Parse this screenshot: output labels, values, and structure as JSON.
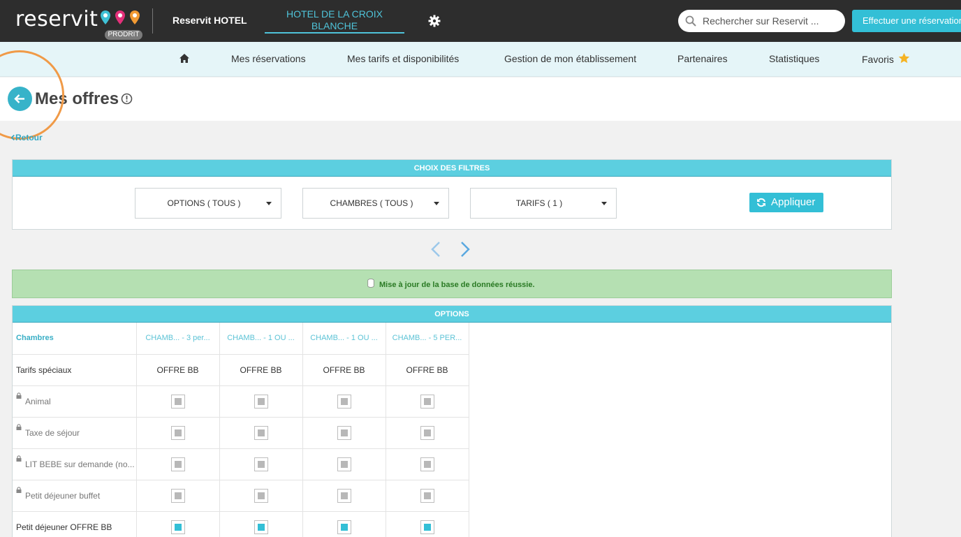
{
  "topbar": {
    "logo_text": "reservit",
    "logo_badge": "PRODRIT",
    "brand_name": "Reservit HOTEL",
    "hotel_name": "HOTEL DE LA CROIX BLANCHE",
    "settings_icon": "gear-icon",
    "search_placeholder": "Rechercher sur Reservit ...",
    "reserve_button": "Effectuer une réservation"
  },
  "nav": {
    "home_icon": "home-icon",
    "items": [
      "Mes réservations",
      "Mes tarifs et disponibilités",
      "Gestion de mon établissement",
      "Partenaires",
      "Statistiques",
      "Favoris"
    ],
    "favorites_icon": "star-icon"
  },
  "page": {
    "title": "Mes offres",
    "back_link": "Retour"
  },
  "filters": {
    "heading": "CHOIX DES FILTRES",
    "options_select": "OPTIONS ( TOUS )",
    "rooms_select": "CHAMBRES ( TOUS )",
    "rates_select": "TARIFS ( 1 )",
    "apply_button": "Appliquer"
  },
  "message": {
    "success": "Mise à jour de la base de données réussie."
  },
  "options": {
    "heading": "OPTIONS",
    "rooms_label": "Chambres",
    "columns": [
      "CHAMB... - 3 per...",
      "CHAMB... - 1 OU ...",
      "CHAMB... - 1 OU ...",
      "CHAMB... - 5 PER..."
    ],
    "special_rates_label": "Tarifs spéciaux",
    "special_rates": [
      "OFFRE BB",
      "OFFRE BB",
      "OFFRE BB",
      "OFFRE BB"
    ],
    "rows": [
      {
        "label": "Animal",
        "locked": true,
        "checked": [
          false,
          false,
          false,
          false
        ]
      },
      {
        "label": "Taxe de séjour",
        "locked": true,
        "checked": [
          false,
          false,
          false,
          false
        ]
      },
      {
        "label": "LIT BEBE sur demande (no...",
        "locked": true,
        "checked": [
          false,
          false,
          false,
          false
        ]
      },
      {
        "label": "Petit déjeuner buffet",
        "locked": true,
        "checked": [
          false,
          false,
          false,
          false
        ]
      },
      {
        "label": "Petit déjeuner OFFRE BB",
        "locked": false,
        "checked": [
          true,
          true,
          true,
          true
        ]
      }
    ]
  },
  "colors": {
    "topbar_bg": "#2d2d2d",
    "accent": "#33bfd6",
    "nav_bg": "#e5f5f8",
    "success_bg": "#b5e0b2",
    "highlight_ring": "#f09a47"
  }
}
